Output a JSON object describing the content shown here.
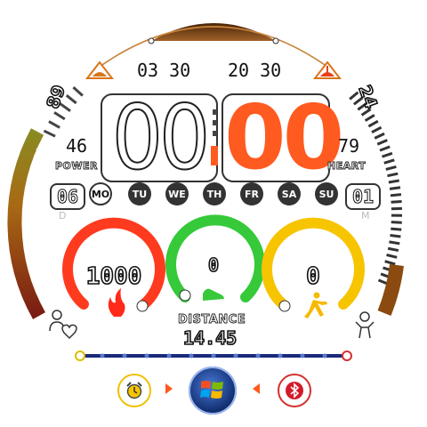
{
  "time": {
    "hours": "00",
    "minutes": "00",
    "separator_colon": ":"
  },
  "sun_times": {
    "sunrise": "03 30",
    "sunset": "20 30"
  },
  "left_arc": {
    "value": "89"
  },
  "right_arc": {
    "value": "24"
  },
  "power": {
    "value": "46",
    "label": "POWER"
  },
  "heart": {
    "value": "79",
    "label": "HEART"
  },
  "date": {
    "day": "06",
    "day_suffix": "D",
    "month": "01",
    "month_suffix": "M"
  },
  "weekdays": [
    {
      "label": "MO",
      "active": true
    },
    {
      "label": "TU",
      "active": false
    },
    {
      "label": "WE",
      "active": false
    },
    {
      "label": "TH",
      "active": false
    },
    {
      "label": "FR",
      "active": false
    },
    {
      "label": "SA",
      "active": false
    },
    {
      "label": "SU",
      "active": false
    }
  ],
  "gauges": [
    {
      "name": "calories",
      "value": "1000",
      "color": "#ff3b1f",
      "icon": "flame-icon"
    },
    {
      "name": "steps",
      "value": "0",
      "color": "#36c93a",
      "icon": "shoe-icon"
    },
    {
      "name": "activity",
      "value": "0",
      "color": "#f7c400",
      "icon": "runner-icon"
    }
  ],
  "distance": {
    "label": "DISTANCE",
    "value": "14.45"
  },
  "colors": {
    "accent": "#ff5a1f",
    "dark": "#222222",
    "sun": "#d9751a",
    "arc_brown": "#7a3c10",
    "progress": "#1a2a7a"
  },
  "bottom": {
    "left_icon": "alarm-icon",
    "center_icon": "windows-logo-icon",
    "right_icon": "bluetooth-icon"
  }
}
